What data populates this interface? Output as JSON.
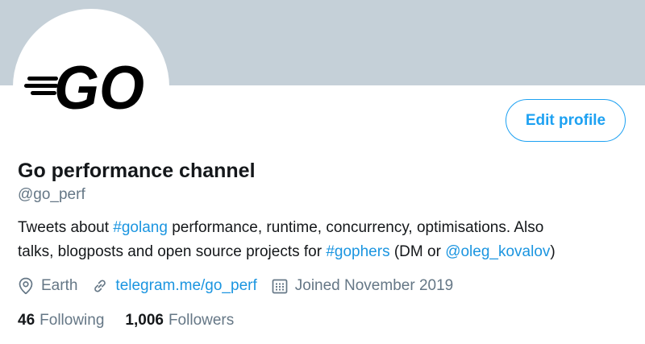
{
  "avatar": {
    "logo_text": "GO"
  },
  "actions": {
    "edit_profile_label": "Edit profile"
  },
  "profile": {
    "name": "Go performance channel",
    "handle": "@go_perf",
    "bio": {
      "line1": [
        {
          "text": "Tweets about ",
          "link": false
        },
        {
          "text": "#golang",
          "link": true
        },
        {
          "text": " performance, runtime, concurrency, optimisations. Also",
          "link": false
        }
      ],
      "line2": [
        {
          "text": "talks, blogposts and open source projects for ",
          "link": false
        },
        {
          "text": "#gophers",
          "link": true
        },
        {
          "text": " (DM or ",
          "link": false
        },
        {
          "text": "@oleg_kovalov",
          "link": true
        },
        {
          "text": ")",
          "link": false
        }
      ]
    },
    "location": "Earth",
    "website": "telegram.me/go_perf",
    "joined": "Joined November 2019"
  },
  "stats": {
    "following_count": "46",
    "following_label": "Following",
    "followers_count": "1,006",
    "followers_label": "Followers"
  },
  "colors": {
    "accent": "#1da1f2",
    "link": "#1b95e0",
    "banner": "#c5d0d8",
    "secondary_text": "#657786"
  },
  "icons": [
    "location-pin-icon",
    "link-icon",
    "calendar-icon"
  ]
}
